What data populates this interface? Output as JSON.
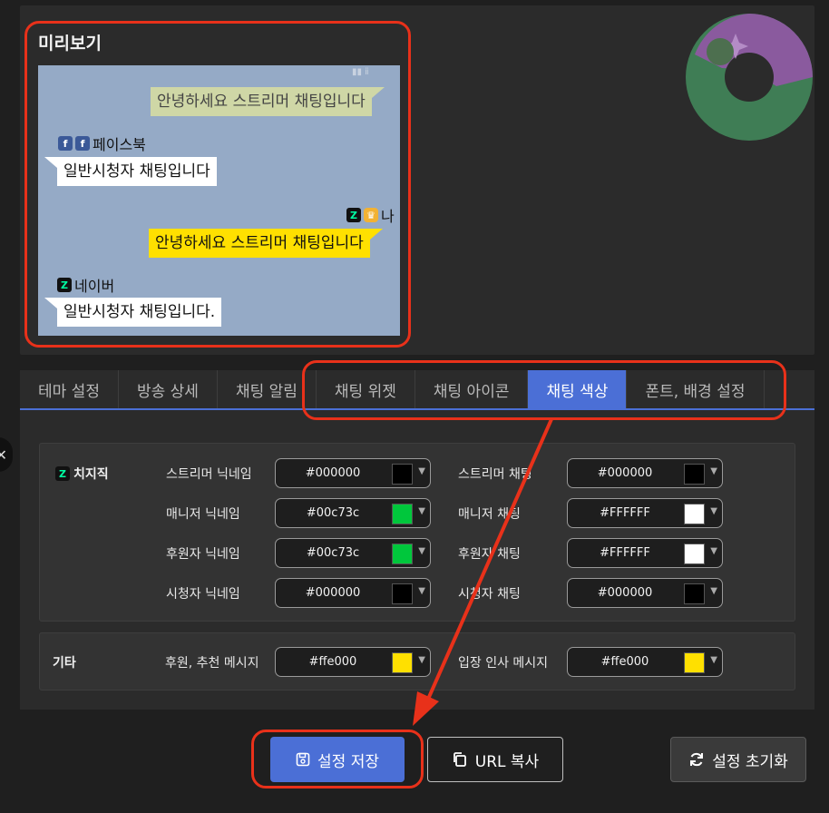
{
  "preview": {
    "title": "미리보기",
    "messages": [
      {
        "text": "안녕하세요 스트리머 채팅입니다"
      },
      {
        "nick": "페이스북",
        "text": "일반시청자 채팅입니다"
      },
      {
        "nick": "나",
        "text": "안녕하세요 스트리머 채팅입니다"
      },
      {
        "nick": "네이버",
        "text": "일반시청자 채팅입니다."
      }
    ]
  },
  "tabs": [
    {
      "label": "테마 설정"
    },
    {
      "label": "방송 상세"
    },
    {
      "label": "채팅 알림"
    },
    {
      "label": "채팅 위젯"
    },
    {
      "label": "채팅 아이콘"
    },
    {
      "label": "채팅 색상"
    },
    {
      "label": "폰트, 배경 설정"
    }
  ],
  "chzzk": {
    "label": "치지직",
    "fields": [
      {
        "label": "스트리머 닉네임",
        "value": "#000000",
        "color": "#000000"
      },
      {
        "label": "스트리머 채팅",
        "value": "#000000",
        "color": "#000000"
      },
      {
        "label": "매니저 닉네임",
        "value": "#00c73c",
        "color": "#00c73c"
      },
      {
        "label": "매니저 채팅",
        "value": "#FFFFFF",
        "color": "#FFFFFF"
      },
      {
        "label": "후원자 닉네임",
        "value": "#00c73c",
        "color": "#00c73c"
      },
      {
        "label": "후원자 채팅",
        "value": "#FFFFFF",
        "color": "#FFFFFF"
      },
      {
        "label": "시청자 닉네임",
        "value": "#000000",
        "color": "#000000"
      },
      {
        "label": "시청자 채팅",
        "value": "#000000",
        "color": "#000000"
      }
    ]
  },
  "etc": {
    "label": "기타",
    "fields": [
      {
        "label": "후원, 추천 메시지",
        "value": "#ffe000",
        "color": "#ffe000"
      },
      {
        "label": "입장 인사 메시지",
        "value": "#ffe000",
        "color": "#ffe000"
      }
    ]
  },
  "buttons": {
    "save": "설정 저장",
    "url": "URL 복사",
    "reset": "설정 초기화"
  },
  "colors": {
    "accent": "#4b6fd6",
    "highlight": "#e8311a"
  }
}
